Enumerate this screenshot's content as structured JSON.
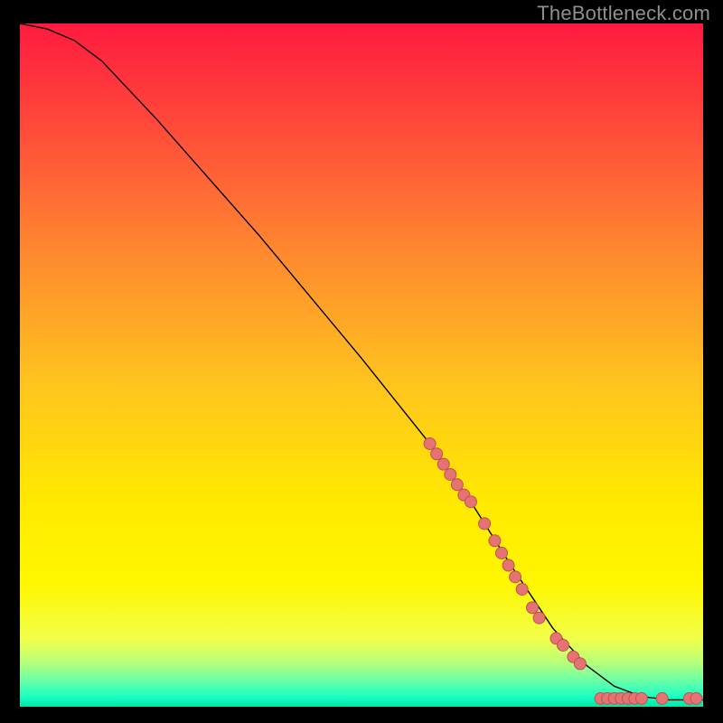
{
  "watermark": "TheBottleneck.com",
  "chart_data": {
    "type": "line",
    "title": "",
    "xlabel": "",
    "ylabel": "",
    "xlim": [
      0,
      100
    ],
    "ylim": [
      0,
      100
    ],
    "grid": false,
    "legend": false,
    "gradient_stops": [
      {
        "offset": 0.0,
        "color": "#ff1a3f"
      },
      {
        "offset": 0.16,
        "color": "#ff4d3a"
      },
      {
        "offset": 0.34,
        "color": "#ff8a2f"
      },
      {
        "offset": 0.52,
        "color": "#ffc21f"
      },
      {
        "offset": 0.7,
        "color": "#ffe900"
      },
      {
        "offset": 0.82,
        "color": "#fff700"
      },
      {
        "offset": 0.9,
        "color": "#f2ff4a"
      },
      {
        "offset": 0.935,
        "color": "#b8ff7a"
      },
      {
        "offset": 0.965,
        "color": "#5fffad"
      },
      {
        "offset": 0.985,
        "color": "#1bffc1"
      },
      {
        "offset": 1.0,
        "color": "#00e6a8"
      }
    ],
    "series": [
      {
        "name": "curve",
        "kind": "line",
        "stroke": "#000000",
        "stroke_width": 1.4,
        "x": [
          0,
          4,
          8,
          12,
          20,
          35,
          50,
          60,
          66,
          72,
          78,
          83,
          87,
          91,
          95,
          100
        ],
        "y": [
          100,
          99.2,
          97.5,
          94.5,
          86.0,
          69.0,
          51.0,
          38.5,
          30.0,
          20.5,
          11.5,
          6.0,
          3.0,
          1.5,
          1.0,
          1.0
        ]
      },
      {
        "name": "markers-on-curve",
        "kind": "scatter",
        "marker_color": "#e57373",
        "marker_stroke": "#c05252",
        "marker_r": 6.5,
        "x": [
          60.0,
          61.0,
          62.0,
          63.0,
          64.0,
          65.0,
          66.0,
          68.0,
          69.5,
          70.5,
          71.5,
          72.5,
          73.5,
          75.0,
          76.0,
          78.5,
          79.5,
          81.0,
          82.0
        ],
        "y": [
          38.5,
          37.0,
          35.5,
          34.0,
          32.5,
          31.0,
          30.0,
          26.8,
          24.3,
          22.5,
          20.7,
          19.0,
          17.2,
          14.5,
          13.0,
          10.0,
          9.0,
          7.3,
          6.3
        ]
      },
      {
        "name": "markers-flat",
        "kind": "scatter",
        "marker_color": "#e57373",
        "marker_stroke": "#c05252",
        "marker_r": 6.5,
        "x": [
          85.0,
          86.0,
          87.0,
          88.0,
          89.0,
          90.0,
          91.0,
          94.0,
          98.0,
          99.0
        ],
        "y": [
          1.2,
          1.2,
          1.2,
          1.2,
          1.2,
          1.2,
          1.2,
          1.2,
          1.2,
          1.2
        ]
      }
    ]
  }
}
